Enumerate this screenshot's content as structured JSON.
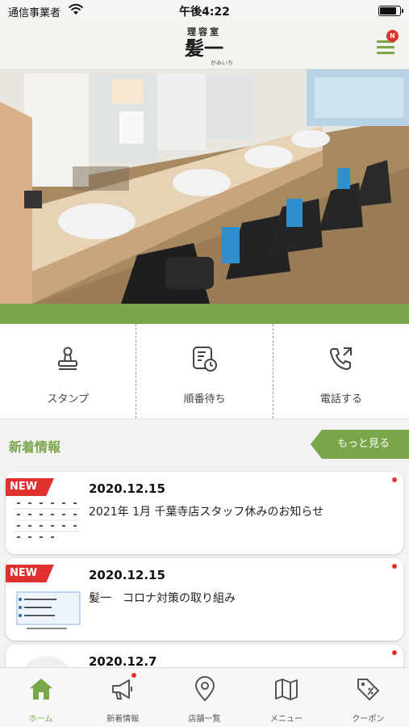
{
  "status_bar": {
    "carrier": "通信事業者",
    "time": "午後4:22",
    "battery_level": 0.85
  },
  "header": {
    "logo_sub": "理容室",
    "logo_main": "髪一",
    "logo_ruby": "かみいち",
    "menu_badge": "N"
  },
  "actions": [
    {
      "label": "スタンプ",
      "icon": "stamp-icon"
    },
    {
      "label": "順番待ち",
      "icon": "queue-clock-icon"
    },
    {
      "label": "電話する",
      "icon": "phone-icon"
    }
  ],
  "news": {
    "title": "新着情報",
    "more_label": "もっと見る",
    "items": [
      {
        "badge": "NEW",
        "date": "2020.12.15",
        "text": "2021年 1月 千葉寺店スタッフ休みのお知らせ",
        "unread": true
      },
      {
        "badge": "NEW",
        "date": "2020.12.15",
        "text": "髪一　コロナ対策の取り組み",
        "unread": true
      },
      {
        "badge": "",
        "date": "2020.12.7",
        "text": "",
        "unread": true
      }
    ]
  },
  "tabs": [
    {
      "label": "ホーム",
      "icon": "home-icon",
      "active": true
    },
    {
      "label": "新着情報",
      "icon": "megaphone-icon",
      "active": false,
      "badge": true
    },
    {
      "label": "店舗一覧",
      "icon": "location-pin-icon",
      "active": false
    },
    {
      "label": "メニュー",
      "icon": "map-icon",
      "active": false
    },
    {
      "label": "クーポン",
      "icon": "coupon-tag-icon",
      "active": false
    }
  ],
  "colors": {
    "accent": "#7aa64a",
    "badge_red": "#e0312f"
  }
}
